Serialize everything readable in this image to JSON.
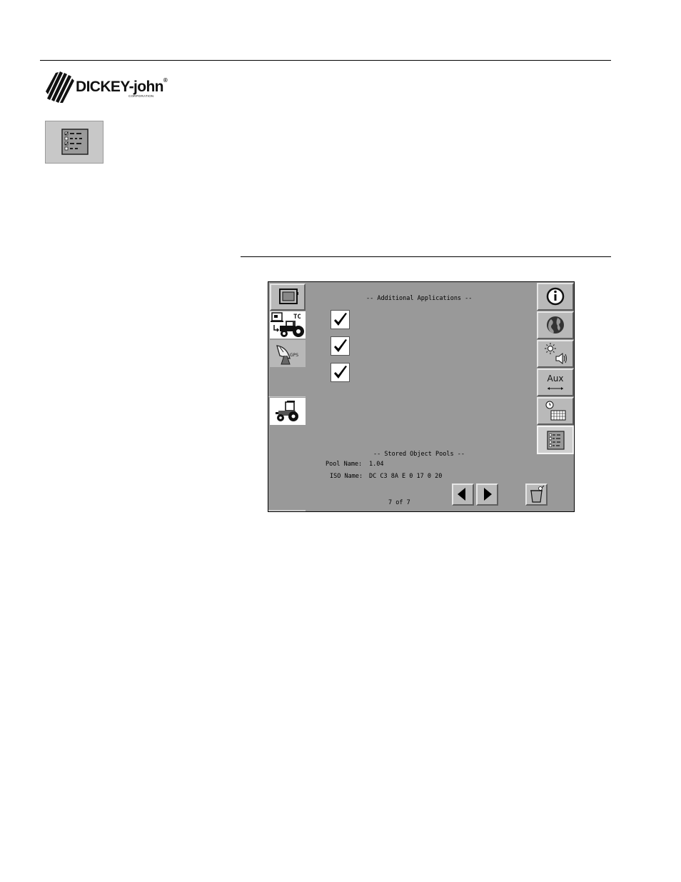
{
  "header": {
    "brand_name": "DICKEY-john",
    "brand_registered": "®",
    "brand_sub": "CORPORATION"
  },
  "sidebar_icon": {
    "name": "checklist-icon"
  },
  "screen": {
    "title": "-- Additional Applications --",
    "checkboxes": [
      {
        "checked": true
      },
      {
        "checked": true
      },
      {
        "checked": true
      }
    ],
    "stored_pools_title": "-- Stored Object Pools --",
    "pool_name_label": "Pool Name:",
    "pool_name_value": "1.04",
    "iso_name_label": "ISO Name:",
    "iso_name_value": "DC C3 8A E 0 17 0 20",
    "page_indicator": "7 of 7",
    "left_tabs": [
      {
        "icon": "monitor-icon"
      },
      {
        "icon": "tractor-tc-icon",
        "badge": "TC"
      },
      {
        "icon": "gps-dish-icon",
        "badge": "GPS"
      },
      {
        "icon": "tractor-icon"
      }
    ],
    "right_tabs": [
      {
        "icon": "info-icon"
      },
      {
        "icon": "globe-icon"
      },
      {
        "icon": "brightness-volume-icon"
      },
      {
        "icon": "aux-icon",
        "label": "Aux"
      },
      {
        "icon": "clock-calendar-icon"
      },
      {
        "icon": "checklist-icon"
      }
    ],
    "nav": {
      "prev": "arrow-left-icon",
      "next": "arrow-right-icon",
      "delete": "trash-icon"
    }
  }
}
